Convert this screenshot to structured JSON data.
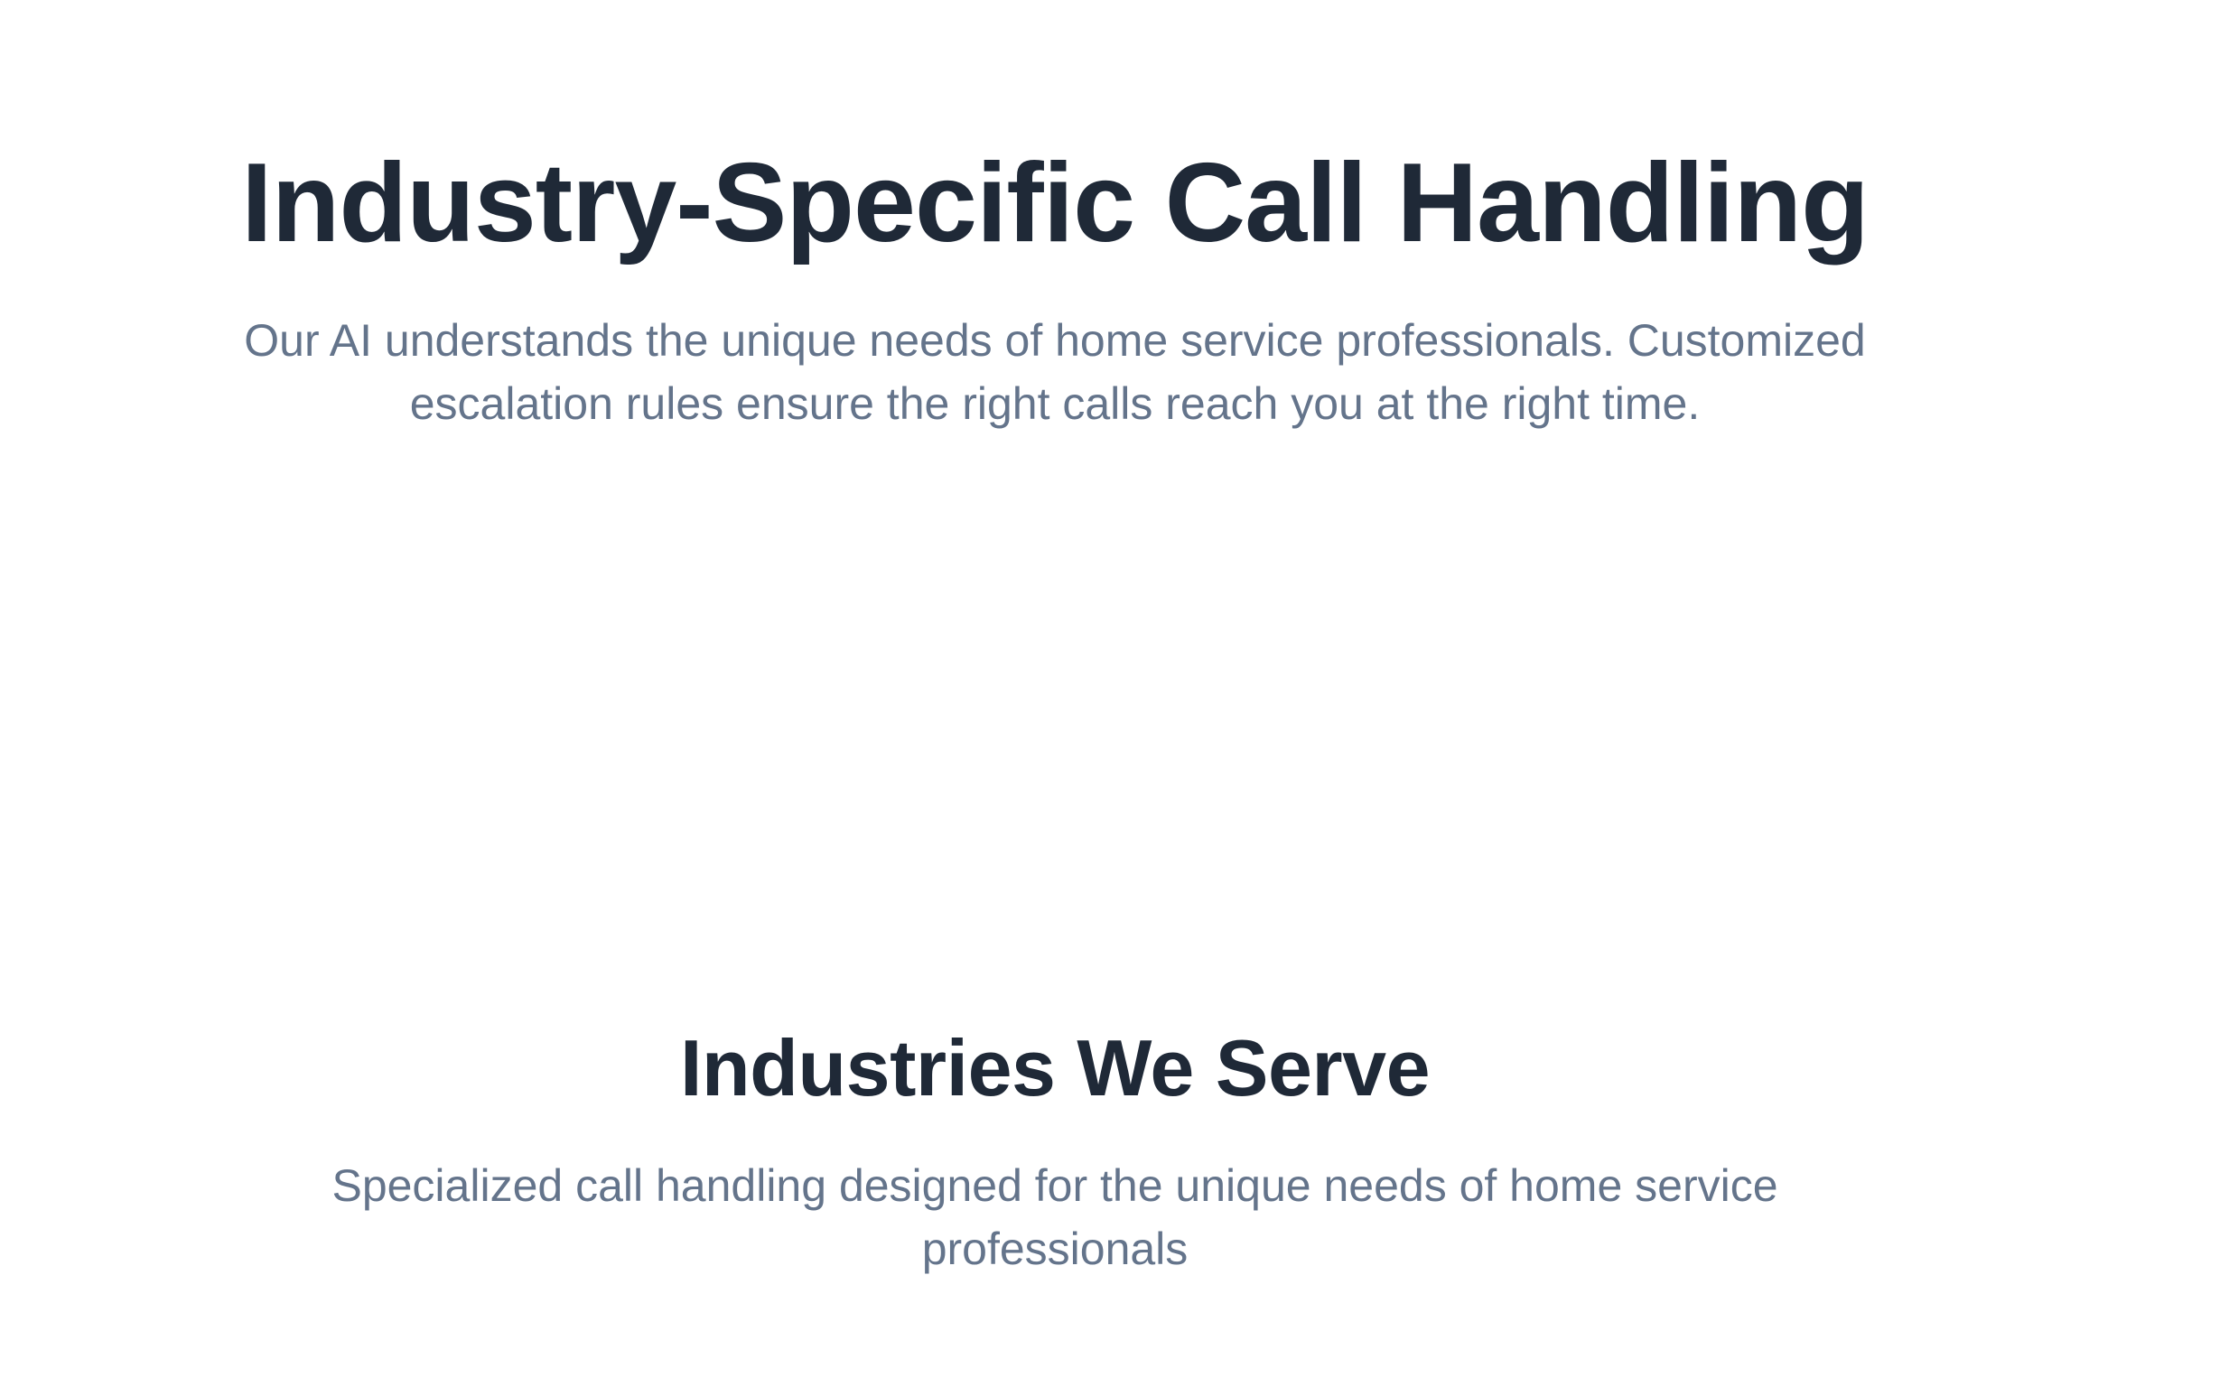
{
  "hero": {
    "title": "Industry-Specific Call Handling",
    "subtitle": "Our AI understands the unique needs of home service professionals. Customized escalation rules ensure the right calls reach you at the right time."
  },
  "industries": {
    "title": "Industries We Serve",
    "subtitle": "Specialized call handling designed for the unique needs of home service professionals"
  },
  "colors": {
    "heading": "#1f2937",
    "body_text": "#64748b",
    "background": "#ffffff"
  }
}
